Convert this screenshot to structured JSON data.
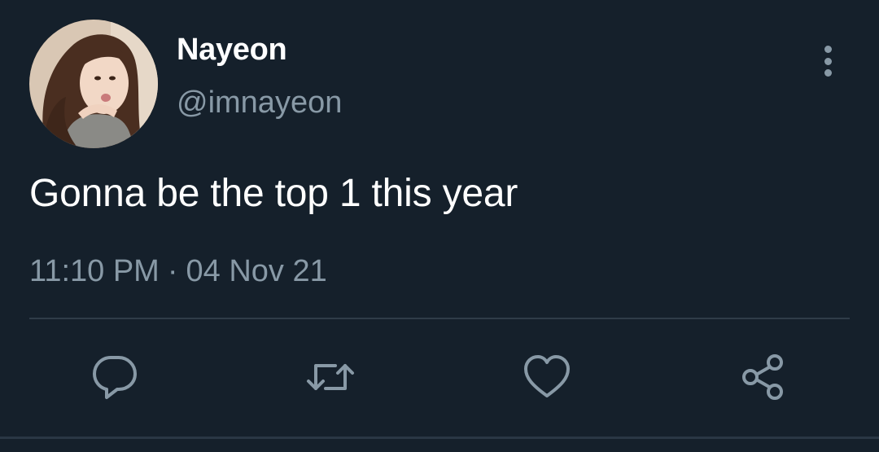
{
  "author": {
    "display_name": "Nayeon",
    "handle": "@imnayeon"
  },
  "tweet": {
    "text": "Gonna be the top 1 this year",
    "time": "11:10 PM",
    "separator": "·",
    "date": "04 Nov 21"
  },
  "icons": {
    "more": "more-vertical-icon",
    "reply": "reply-icon",
    "retweet": "retweet-icon",
    "like": "heart-icon",
    "share": "share-icon"
  },
  "colors": {
    "background": "#15202b",
    "primary_text": "#ffffff",
    "secondary_text": "#8899a6",
    "divider": "#2f3c48"
  }
}
